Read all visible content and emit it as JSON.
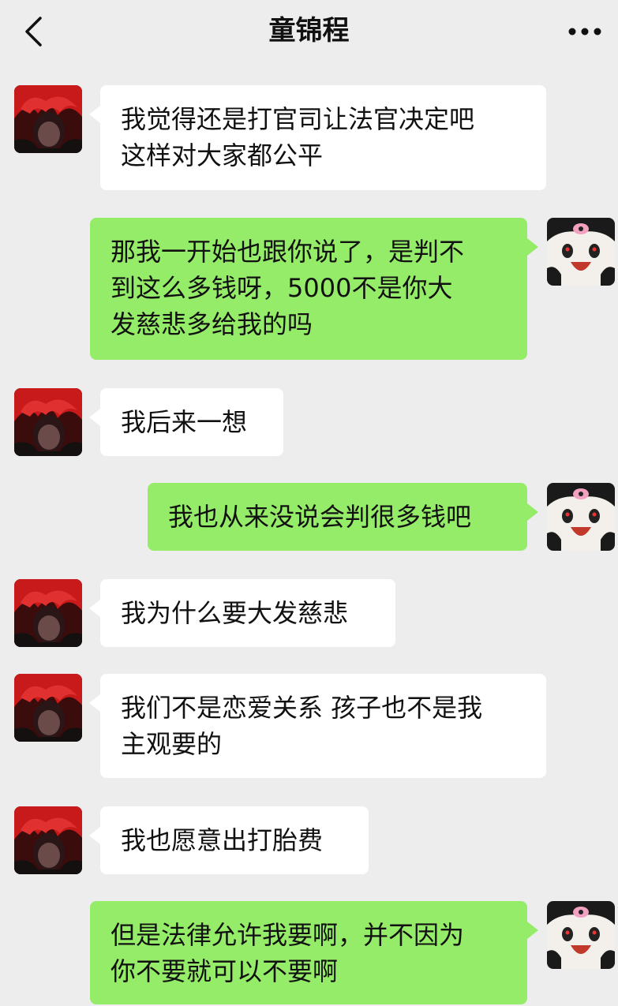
{
  "header": {
    "title": "童锦程",
    "back_icon": "chevron-left-icon",
    "more_icon": "ellipsis-icon"
  },
  "colors": {
    "background": "#ededed",
    "incoming_bubble": "#ffffff",
    "outgoing_bubble": "#95ec69",
    "text": "#111111"
  },
  "messages": [
    {
      "side": "incoming",
      "text": "我觉得还是打官司让法官决定吧\n这样对大家都公平"
    },
    {
      "side": "outgoing",
      "text": "那我一开始也跟你说了，是判不\n到这么多钱呀，5000不是你大\n发慈悲多给我的吗"
    },
    {
      "side": "incoming",
      "text": "我后来一想"
    },
    {
      "side": "outgoing",
      "text": "我也从来没说会判很多钱吧"
    },
    {
      "side": "incoming",
      "text": "我为什么要大发慈悲"
    },
    {
      "side": "incoming",
      "text": "我们不是恋爱关系 孩子也不是我\n主观要的"
    },
    {
      "side": "incoming",
      "text": "我也愿意出打胎费"
    },
    {
      "side": "outgoing",
      "text": "但是法律允许我要啊，并不因为\n你不要就可以不要啊"
    }
  ]
}
